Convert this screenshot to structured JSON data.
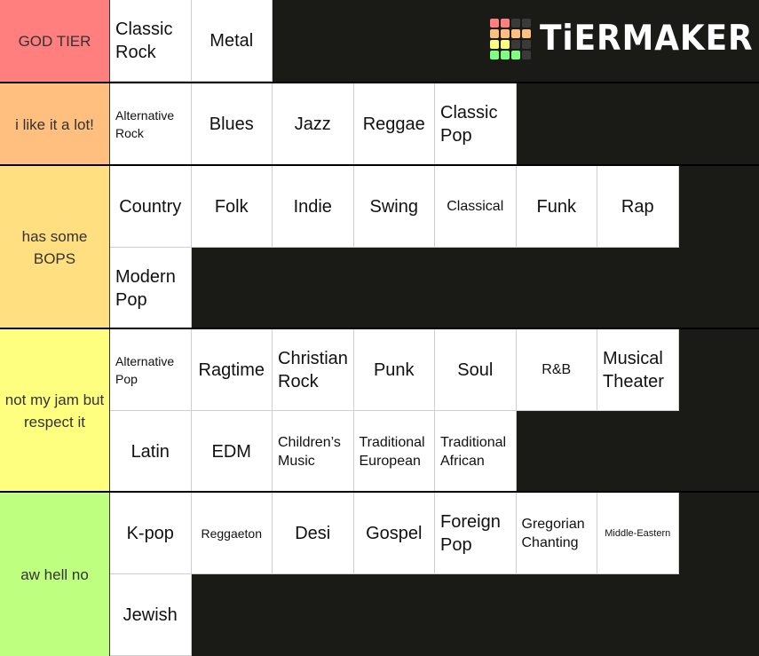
{
  "app": {
    "logo_text": "TiERMAKER"
  },
  "logo_grid": [
    [
      "#ff7f7f",
      "#ff7f7f",
      "#3a3a3a",
      "#3a3a3a"
    ],
    [
      "#ffbf7f",
      "#ffbf7f",
      "#ffbf7f",
      "#ffbf7f"
    ],
    [
      "#ffff7f",
      "#ffff7f",
      "#3a3a3a",
      "#3a3a3a"
    ],
    [
      "#7fff7f",
      "#7fff7f",
      "#7fff7f",
      "#3a3a3a"
    ]
  ],
  "tiers": [
    {
      "label": "GOD TIER",
      "color": "#ff7f7f",
      "items": [
        {
          "text": "Classic Rock",
          "size": "lg",
          "align": "left"
        },
        {
          "text": "Metal",
          "size": "lg",
          "align": "center"
        }
      ]
    },
    {
      "label": "i like it a lot!",
      "color": "#ffbf7f",
      "items": [
        {
          "text": "Alternative Rock",
          "size": "sm",
          "align": "left"
        },
        {
          "text": "Blues",
          "size": "lg",
          "align": "center"
        },
        {
          "text": "Jazz",
          "size": "lg",
          "align": "center"
        },
        {
          "text": "Reggae",
          "size": "lg",
          "align": "center"
        },
        {
          "text": "Classic Pop",
          "size": "lg",
          "align": "left"
        }
      ]
    },
    {
      "label": "has some BOPS",
      "color": "#ffdf7f",
      "items": [
        {
          "text": "Country",
          "size": "lg",
          "align": "center"
        },
        {
          "text": "Folk",
          "size": "lg",
          "align": "center"
        },
        {
          "text": "Indie",
          "size": "lg",
          "align": "center"
        },
        {
          "text": "Swing",
          "size": "lg",
          "align": "center"
        },
        {
          "text": "Classical",
          "size": "md",
          "align": "center"
        },
        {
          "text": "Funk",
          "size": "lg",
          "align": "center"
        },
        {
          "text": "Rap",
          "size": "lg",
          "align": "center"
        },
        {
          "text": "Modern Pop",
          "size": "lg",
          "align": "left"
        }
      ]
    },
    {
      "label": "not my jam but respect it",
      "color": "#ffff7f",
      "items": [
        {
          "text": "Alternative Pop",
          "size": "sm",
          "align": "left"
        },
        {
          "text": "Ragtime",
          "size": "lg",
          "align": "center"
        },
        {
          "text": "Christian Rock",
          "size": "lg",
          "align": "left"
        },
        {
          "text": "Punk",
          "size": "lg",
          "align": "center"
        },
        {
          "text": "Soul",
          "size": "lg",
          "align": "center"
        },
        {
          "text": "R&B",
          "size": "md",
          "align": "center"
        },
        {
          "text": "Musical Theater",
          "size": "lg",
          "align": "left"
        },
        {
          "text": "Latin",
          "size": "lg",
          "align": "center"
        },
        {
          "text": "EDM",
          "size": "lg",
          "align": "center"
        },
        {
          "text": "Children’s Music",
          "size": "md",
          "align": "left"
        },
        {
          "text": "Traditional European",
          "size": "md",
          "align": "left"
        },
        {
          "text": "Traditional African",
          "size": "md",
          "align": "left"
        }
      ]
    },
    {
      "label": "aw hell no",
      "color": "#bfff7f",
      "items": [
        {
          "text": "K-pop",
          "size": "lg",
          "align": "center"
        },
        {
          "text": "Reggaeton",
          "size": "sm",
          "align": "center"
        },
        {
          "text": "Desi",
          "size": "lg",
          "align": "center"
        },
        {
          "text": "Gospel",
          "size": "lg",
          "align": "center"
        },
        {
          "text": "Foreign Pop",
          "size": "lg",
          "align": "left"
        },
        {
          "text": "Gregorian Chanting",
          "size": "md",
          "align": "left"
        },
        {
          "text": "Middle-Eastern",
          "size": "xs",
          "align": "center"
        },
        {
          "text": "Jewish",
          "size": "lg",
          "align": "center"
        }
      ]
    }
  ]
}
